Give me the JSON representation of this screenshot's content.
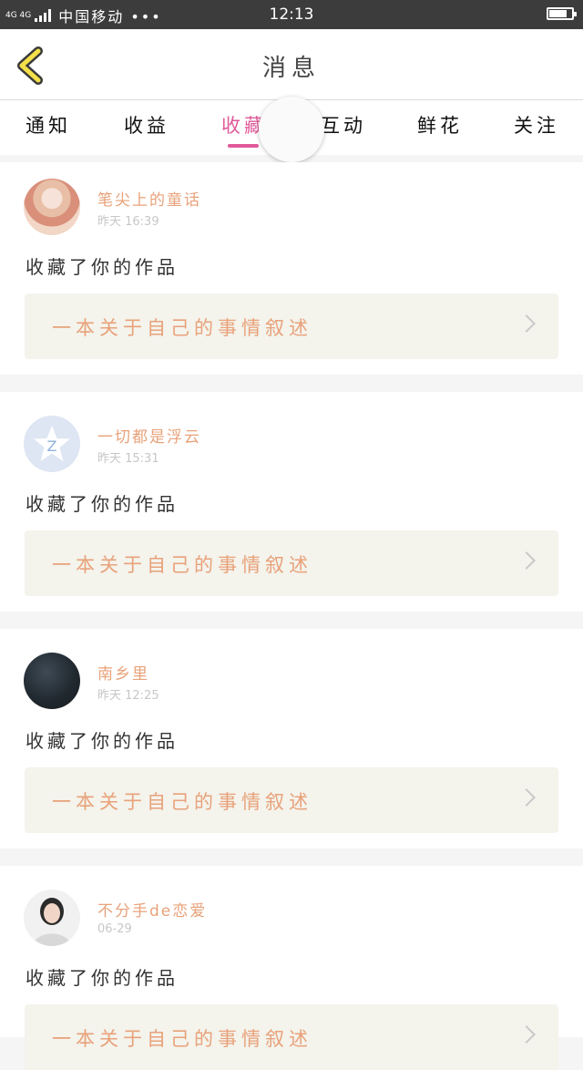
{
  "status_bar": {
    "network": "4G 4G",
    "carrier": "中国移动 •••",
    "time": "12:13",
    "battery_level": 0.8
  },
  "header": {
    "title": "消息",
    "back_icon": "chevron-left-icon"
  },
  "tabs": [
    {
      "label": "通知"
    },
    {
      "label": "收益"
    },
    {
      "label": "收藏",
      "active": true
    },
    {
      "label": "互动"
    },
    {
      "label": "鲜花"
    },
    {
      "label": "关注"
    }
  ],
  "colors": {
    "accent": "#e05a9a",
    "name": "#e8a27a",
    "work_bg": "#f4f3ec"
  },
  "messages": [
    {
      "user": "笔尖上的童话",
      "time": "昨天 16:39",
      "action": "收藏了你的作品",
      "work_title": "一本关于自己的事情叙述"
    },
    {
      "user": "一切都是浮云",
      "time": "昨天 15:31",
      "action": "收藏了你的作品",
      "work_title": "一本关于自己的事情叙述"
    },
    {
      "user": "南乡里",
      "time": "昨天 12:25",
      "action": "收藏了你的作品",
      "work_title": "一本关于自己的事情叙述"
    },
    {
      "user": "不分手de恋爱",
      "time": "06-29",
      "action": "收藏了你的作品",
      "work_title": "一本关于自己的事情叙述"
    }
  ]
}
